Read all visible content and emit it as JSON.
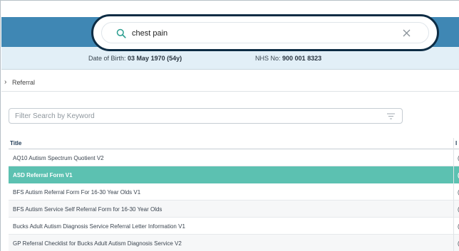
{
  "search": {
    "query": "chest pain"
  },
  "patient": {
    "dob_label": "Date of Birth:",
    "dob_value": "03 May 1970 (54y)",
    "nhs_label": "NHS No:",
    "nhs_value": "900 001 8323"
  },
  "breadcrumb": {
    "label": "Referral"
  },
  "filter": {
    "placeholder": "Filter Search by Keyword",
    "value": ""
  },
  "table": {
    "headers": [
      "Title",
      "I"
    ],
    "rows": [
      {
        "title": "AQ10 Autism Spectrum Quotient V2",
        "col2": "("
      },
      {
        "title": "ASD Referral Form V1",
        "col2": "("
      },
      {
        "title": "BFS Autism Referral Form For 16-30 Year Olds V1",
        "col2": "("
      },
      {
        "title": "BFS Autism Service Self Referral Form for 16-30 Year Olds",
        "col2": "("
      },
      {
        "title": "Bucks Adult Autism Diagnosis Service Referral Letter Information V1",
        "col2": "("
      },
      {
        "title": "GP Referral Checklist for Bucks Adult Autism Diagnosis Service V2",
        "col2": "("
      }
    ],
    "selected_index": 1
  },
  "colors": {
    "header_blue": "#3f87b4",
    "selected_row": "#5cc1b1",
    "search_focus_ring": "#0d2c44",
    "search_icon": "#2a9d8f"
  },
  "icons": {
    "search": "search-icon",
    "clear": "close-icon",
    "breadcrumb": "chevron-right-icon",
    "filter": "filter-icon"
  }
}
